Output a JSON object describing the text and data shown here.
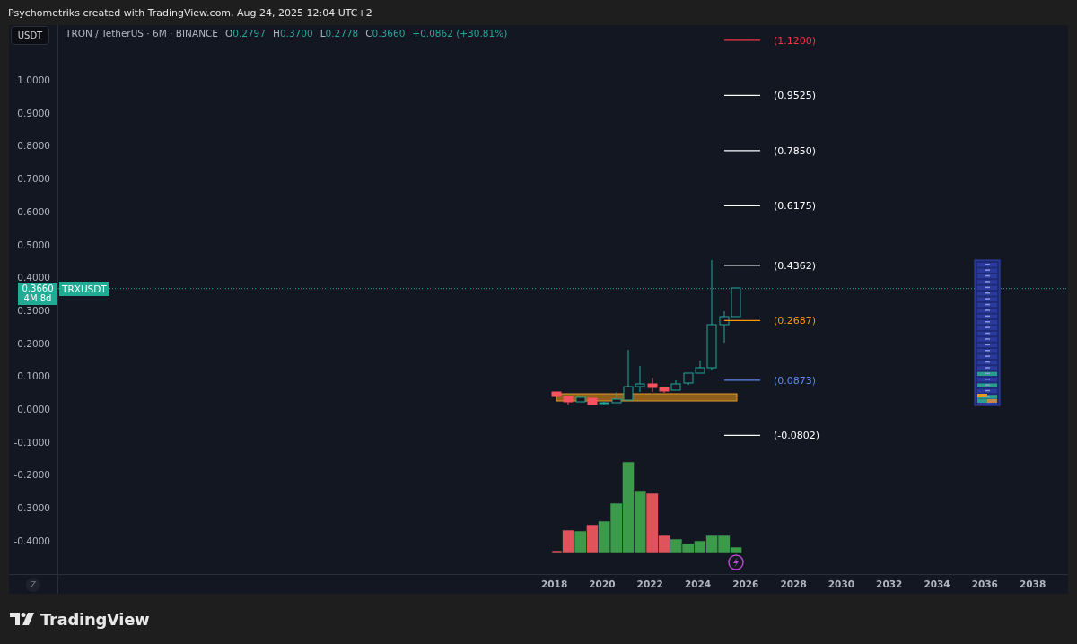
{
  "header": {
    "title": "Psychometriks created with TradingView.com, Aug 24, 2025 12:04 UTC+2"
  },
  "chart": {
    "currency_button": "USDT",
    "legend": {
      "symbol": "TRON / TetherUS · 6M · BINANCE",
      "ohlc": [
        {
          "label": "O",
          "value": "0.2797"
        },
        {
          "label": "H",
          "value": "0.3700"
        },
        {
          "label": "L",
          "value": "0.2778"
        },
        {
          "label": "C",
          "value": "0.3660"
        }
      ],
      "change": "+0.0862 (+30.81%)"
    },
    "price_axis": [
      "1.0000",
      "0.9000",
      "0.8000",
      "0.7000",
      "0.6000",
      "0.5000",
      "0.4000",
      "0.3000",
      "0.2000",
      "0.1000",
      "0.0000",
      "-0.1000",
      "-0.2000",
      "-0.3000",
      "-0.4000"
    ],
    "last_price": {
      "price": "0.3660",
      "countdown": "4M 8d",
      "symbol": "TRXUSDT"
    },
    "fib_levels": [
      {
        "label": "(1.1200)",
        "color": "#f23645"
      },
      {
        "label": "(0.9525)",
        "color": "#ffffff"
      },
      {
        "label": "(0.7850)",
        "color": "#ffffff"
      },
      {
        "label": "(0.6175)",
        "color": "#ffffff"
      },
      {
        "label": "(0.4362)",
        "color": "#ffffff"
      },
      {
        "label": "(0.2687)",
        "color": "#ff9800"
      },
      {
        "label": "(0.0873)",
        "color": "#5b8def"
      },
      {
        "label": "(-0.0802)",
        "color": "#ffffff"
      }
    ],
    "time_axis": [
      "2018",
      "2020",
      "2022",
      "2024",
      "2026",
      "2028",
      "2030",
      "2032",
      "2034",
      "2036",
      "2038"
    ],
    "scale_button": "Z"
  },
  "footer": {
    "logo": "TradingView"
  }
}
